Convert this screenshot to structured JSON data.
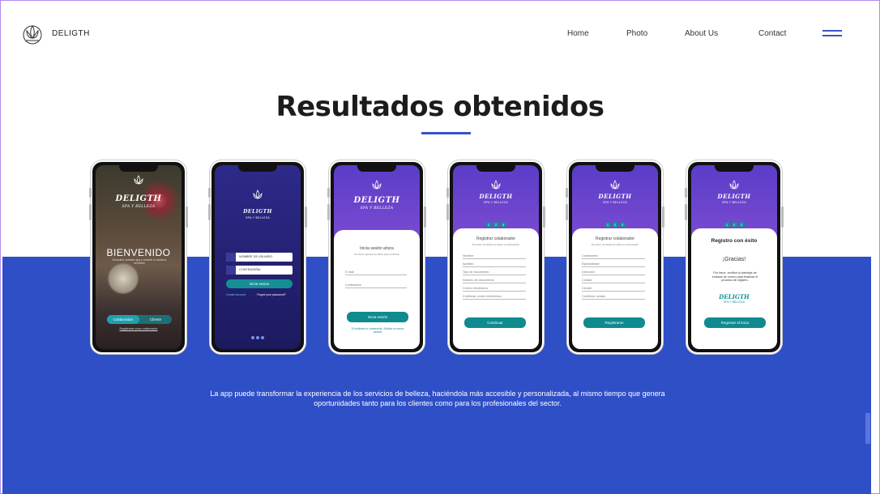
{
  "header": {
    "brand": "DELIGTH",
    "nav": [
      "Home",
      "Photo",
      "About Us",
      "Contact"
    ]
  },
  "main": {
    "title": "Resultados obtenidos",
    "description": "La app puede transformar la experiencia de los servicios de belleza, haciéndola más accesible y personalizada, al mismo tiempo que genera oportunidades tanto para los clientes como para los profesionales del sector."
  },
  "phones": {
    "brand": "DELIGTH",
    "sub": "SPA Y BELLEZA",
    "p1": {
      "welcome": "BIENVENIDO",
      "welcome_sub": "Descubre nuestra app y accede a nuestros servicios",
      "tab_a": "Colaborador",
      "tab_b": "Cliente",
      "footer": "Registrarse como colaborador"
    },
    "p2": {
      "user_placeholder": "NOMBRE DE USUARIO",
      "pass_placeholder": "CONTRASEÑA",
      "login": "Inicia sesion",
      "create": "Create Account",
      "forgot": "Forgot your password?"
    },
    "p3": {
      "heading": "Inicia sesión ahora",
      "subheading": "Por favor ingresa tus datos para continuar",
      "email": "E-mail",
      "password": "Contraseña",
      "button": "Inicia sesión",
      "footer": "Si olvidaste tu contraseña, Solicita un nuevo cambio"
    },
    "p4": {
      "heading": "Registrar colaborador",
      "subheading": "Por favor completa los datos a continuación",
      "steps": [
        "1",
        "2",
        "3"
      ],
      "fields": [
        "Nombre",
        "Apellido",
        "Tipo de documento",
        "Número de documento",
        "Correo electrónico",
        "Confirmar correo electrónico"
      ],
      "button": "Continuar"
    },
    "p5": {
      "heading": "Registrar colaborador",
      "subheading": "Por favor completa los datos a continuación",
      "steps": [
        "1",
        "2",
        "3"
      ],
      "fields": [
        "Contraseña",
        "Especialidad",
        "Dirección",
        "Ciudad",
        "Celular",
        "Confirmar celular"
      ],
      "button": "Registrarse"
    },
    "p6": {
      "heading": "Registro con éxito",
      "steps": [
        "1",
        "2",
        "3"
      ],
      "thanks": "¡Gracias!",
      "message": "Por favor, verifica tu bandeja de entrada de correo para finalizar el proceso de registro.",
      "button": "Regresar al inicio"
    }
  },
  "colors": {
    "accent": "#3b52c7",
    "band": "#2f4fc7",
    "teal": "#0f8a8f",
    "purple": "#4b2fb8"
  }
}
